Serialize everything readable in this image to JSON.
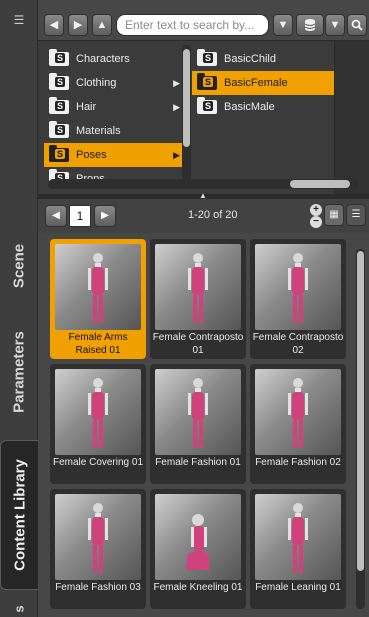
{
  "side_tabs": {
    "menu_icon": "panel-menu-icon",
    "scene": "Scene",
    "parameters": "Parameters",
    "content_library": "Content Library",
    "fourth_partial": "s"
  },
  "toolbar": {
    "back_icon": "◀",
    "forward_icon": "▶",
    "up_icon": "▲",
    "search_placeholder": "Enter text to search by...",
    "dropdown_icon": "▼",
    "db_icon": "database-icon",
    "options_icon": "▼",
    "find_icon": "search-icon"
  },
  "categories": [
    {
      "label": "Characters",
      "has_children": false
    },
    {
      "label": "Clothing",
      "has_children": true
    },
    {
      "label": "Hair",
      "has_children": true
    },
    {
      "label": "Materials",
      "has_children": false
    },
    {
      "label": "Poses",
      "has_children": true,
      "selected": true
    },
    {
      "label": "Props",
      "has_children": false
    }
  ],
  "subcategories": [
    {
      "label": "BasicChild"
    },
    {
      "label": "BasicFemale",
      "selected": true
    },
    {
      "label": "BasicMale"
    }
  ],
  "pager": {
    "prev_icon": "◀",
    "page": "1",
    "next_icon": "▶",
    "range": "1-20 of 20",
    "zoom_in": "+",
    "zoom_out": "−",
    "grid_icon": "▦",
    "list_icon": "☰"
  },
  "accent": "#f0a000",
  "tiles": [
    {
      "label": "Female Arms Raised 01",
      "selected": true
    },
    {
      "label": "Female Contraposto 01"
    },
    {
      "label": "Female Contraposto 02"
    },
    {
      "label": "Female Covering 01"
    },
    {
      "label": "Female Fashion 01"
    },
    {
      "label": "Female Fashion 02"
    },
    {
      "label": "Female Fashion 03"
    },
    {
      "label": "Female Kneeling 01"
    },
    {
      "label": "Female Leaning 01"
    }
  ]
}
